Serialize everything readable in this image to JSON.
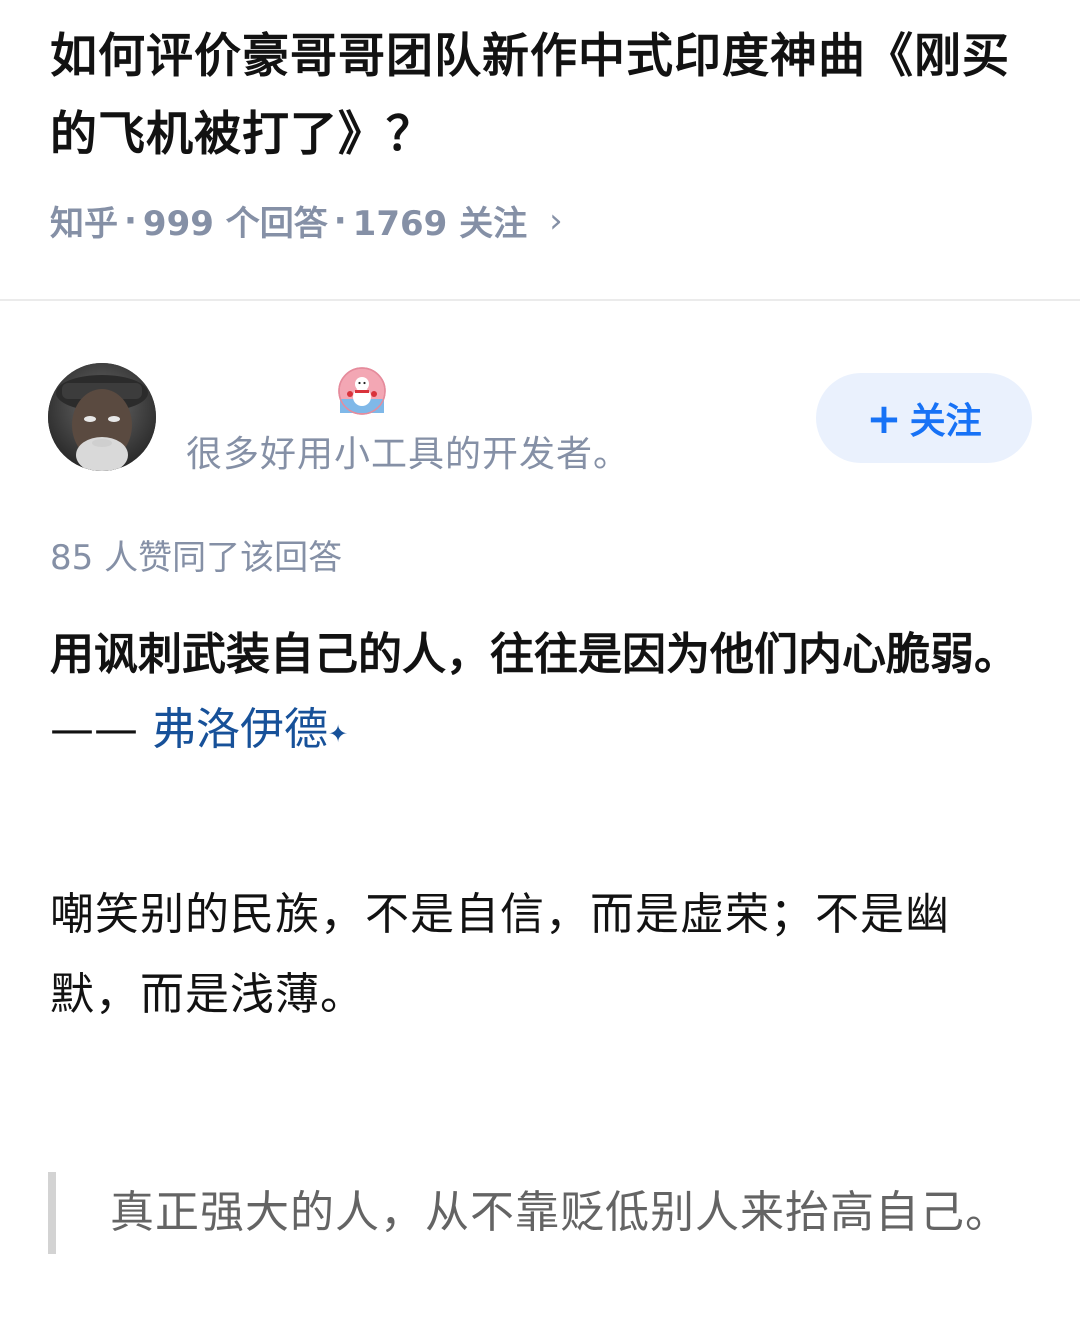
{
  "question": {
    "title": "如何评价豪哥哥团队新作中式印度神曲《刚买的飞机被打了》？",
    "source": "知乎",
    "separator": "·",
    "answers_count": "999 个回答",
    "followers_count": "1769 关注",
    "chevron": "›"
  },
  "author": {
    "bio": "很多好用小工具的开发者。",
    "avatar_icon": "avatar-photo",
    "badge_icon": "snowman-badge-icon",
    "follow_label": "关注",
    "follow_plus": "+"
  },
  "answer": {
    "vote_text": "85 人赞同了该回答",
    "bold_quote": "用讽刺武装自己的人，往往是因为他们内心脆弱。",
    "attribution_prefix": "—— ",
    "attribution_author": "弗洛伊德",
    "attribution_sparkle": "✦",
    "paragraph": "嘲笑别的民族，不是自信，而是虚荣；不是幽默，而是浅薄。",
    "blockquote": "真正强大的人，从不靠贬低别人来抬高自己。"
  },
  "colors": {
    "accent": "#1772f6",
    "link": "#175199",
    "meta_gray": "#8590a6",
    "follow_bg": "#eaf1fd"
  }
}
